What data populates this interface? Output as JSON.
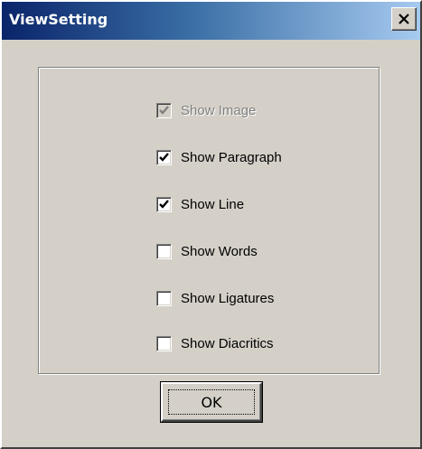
{
  "window": {
    "title": "ViewSetting",
    "close_glyph": "×",
    "close_icon": "close-icon"
  },
  "options": [
    {
      "label": "Show Image",
      "checked": true,
      "enabled": false
    },
    {
      "label": "Show Paragraph",
      "checked": true,
      "enabled": true
    },
    {
      "label": "Show Line",
      "checked": true,
      "enabled": true
    },
    {
      "label": "Show Words",
      "checked": false,
      "enabled": true
    },
    {
      "label": "Show Ligatures",
      "checked": false,
      "enabled": true
    },
    {
      "label": "Show Diacritics",
      "checked": false,
      "enabled": true
    }
  ],
  "buttons": {
    "ok_label": "OK"
  },
  "colors": {
    "titlebar_start": "#0a246a",
    "titlebar_end": "#a6caf0",
    "face": "#d4d0c8"
  }
}
